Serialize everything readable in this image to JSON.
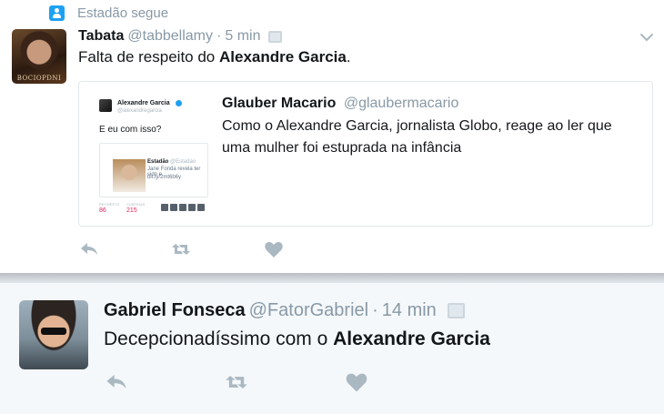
{
  "social_context": {
    "text": "Estadão segue",
    "icon": "person-icon"
  },
  "tweet1": {
    "name": "Tabata",
    "handle": "@tabbellamy",
    "separator": "·",
    "time": "5 min",
    "avatar_watermark": "BOCIOPDNI",
    "text_prefix": "Falta de respeito do ",
    "text_bold": "Alexandre Garcia",
    "text_suffix": ".",
    "quote": {
      "name": "Glauber Macario",
      "handle": "@glaubermacario",
      "text": "Como o Alexandre Garcia, jornalista Globo, reage ao ler que uma mulher foi estuprada na infância",
      "thumbnail": {
        "name": "Alexandre Garcia",
        "handle": "@alexandregarcia",
        "text": "E eu com isso?",
        "card_source": "Estadão",
        "card_source_handle": "@Estadao",
        "card_text": "Jane Fonda revela ter sido e",
        "card_link": "bit.ly/2mt6b6y",
        "retweets_label": "RETWEETS",
        "retweets": "86",
        "likes_label": "CURTIDAS",
        "likes": "215"
      }
    },
    "actions": [
      "reply-icon",
      "retweet-icon",
      "like-icon"
    ]
  },
  "tweet2": {
    "name": "Gabriel Fonseca",
    "handle": "@FatorGabriel",
    "separator": "·",
    "time": "14 min",
    "text_prefix": "Decepcionadíssimo com o ",
    "text_bold": "Alexandre Garcia",
    "actions": [
      "reply-icon",
      "retweet-icon",
      "like-icon"
    ]
  },
  "colors": {
    "accent": "#1da1f2",
    "muted": "#8899a6",
    "action_icons": "#aab8c2",
    "text": "#14171a",
    "like_red": "#e0245e"
  }
}
